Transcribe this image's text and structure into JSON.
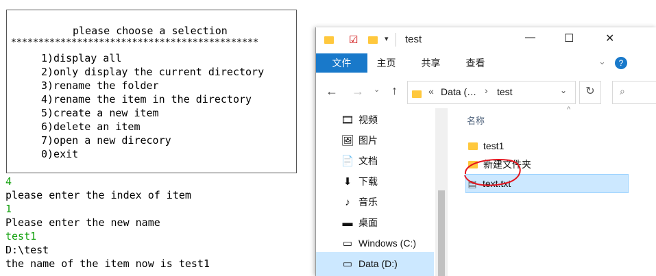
{
  "console": {
    "top_cut": "                                                                                       ",
    "menu_title": "please choose a selection",
    "menu_stars": "*********************************************",
    "menu_items": [
      "1)display all",
      "2)only display the current directory",
      "3)rename the folder",
      "4)rename the item in the directory",
      "5)create a new item",
      "6)delete an item",
      "7)open a new direcory",
      "0)exit"
    ],
    "lines": [
      {
        "text": "4",
        "color": "green"
      },
      {
        "text": "please enter the index of item",
        "color": "black"
      },
      {
        "text": "1",
        "color": "green"
      },
      {
        "text": "Please enter the new name",
        "color": "black"
      },
      {
        "text": "test1",
        "color": "green"
      },
      {
        "text": "D:\\test",
        "color": "black"
      },
      {
        "text": "the name of the item now is test1",
        "color": "black"
      }
    ]
  },
  "explorer": {
    "window_title": "test",
    "window_controls": {
      "minimize": "—",
      "maximize": "☐",
      "close": "✕"
    },
    "ribbon_tabs": [
      "文件",
      "主页",
      "共享",
      "查看"
    ],
    "address_prefix": "«",
    "address_parent": "Data (…",
    "address_current": "test",
    "nav_items": [
      {
        "icon": "video-icon",
        "glyph": "🎞",
        "label": "视频"
      },
      {
        "icon": "picture-icon",
        "glyph": "🖼",
        "label": "图片"
      },
      {
        "icon": "document-icon",
        "glyph": "📄",
        "label": "文档"
      },
      {
        "icon": "download-icon",
        "glyph": "⬇",
        "label": "下载"
      },
      {
        "icon": "music-icon",
        "glyph": "♪",
        "label": "音乐"
      },
      {
        "icon": "desktop-icon",
        "glyph": "▬",
        "label": "桌面"
      },
      {
        "icon": "drive-icon",
        "glyph": "▭",
        "label": "Windows (C:)"
      },
      {
        "icon": "drive-icon",
        "glyph": "▭",
        "label": "Data (D:)"
      }
    ],
    "column_header": "名称",
    "files": [
      {
        "type": "folder",
        "name": "test1"
      },
      {
        "type": "folder",
        "name": "新建文件夹"
      },
      {
        "type": "text",
        "name": "text.txt"
      }
    ]
  }
}
